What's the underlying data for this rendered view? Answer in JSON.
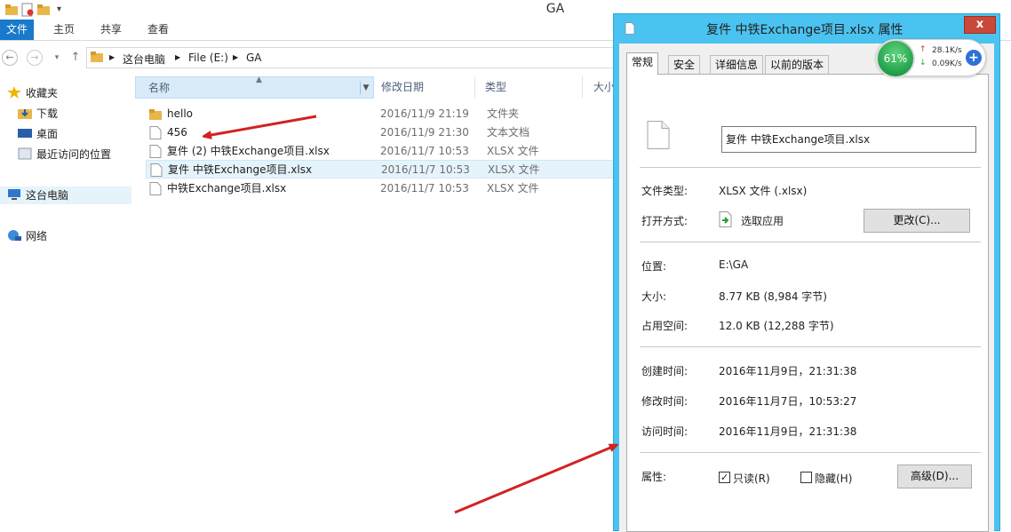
{
  "window": {
    "title": "GA"
  },
  "ribbon": {
    "tabs": [
      "文件",
      "主页",
      "共享",
      "查看"
    ]
  },
  "address": {
    "parts": [
      "这台电脑",
      "File (E:)",
      "GA"
    ]
  },
  "nav_pane": {
    "favorites": "收藏夹",
    "downloads": "下载",
    "desktop": "桌面",
    "recent": "最近访问的位置",
    "this_pc": "这台电脑",
    "network": "网络"
  },
  "columns": {
    "name": "名称",
    "modified": "修改日期",
    "type": "类型",
    "size": "大小"
  },
  "files": [
    {
      "name": "hello",
      "date": "2016/11/9 21:19",
      "type": "文件夹",
      "icon": "folder-icon"
    },
    {
      "name": "456",
      "date": "2016/11/9 21:30",
      "type": "文本文档",
      "icon": "text-file-icon"
    },
    {
      "name": "复件 (2) 中铁Exchange项目.xlsx",
      "date": "2016/11/7 10:53",
      "type": "XLSX 文件",
      "icon": "file-icon"
    },
    {
      "name": "复件 中铁Exchange项目.xlsx",
      "date": "2016/11/7 10:53",
      "type": "XLSX 文件",
      "icon": "file-icon"
    },
    {
      "name": "中铁Exchange项目.xlsx",
      "date": "2016/11/7 10:53",
      "type": "XLSX 文件",
      "icon": "file-icon"
    }
  ],
  "properties": {
    "title": "复件 中铁Exchange项目.xlsx 属性",
    "close": "x",
    "tabs": [
      "常规",
      "安全",
      "详细信息",
      "以前的版本"
    ],
    "filename": "复件 中铁Exchange项目.xlsx",
    "file_type_label": "文件类型:",
    "file_type_value": "XLSX 文件 (.xlsx)",
    "open_with_label": "打开方式:",
    "open_with_value": "选取应用",
    "change_button": "更改(C)...",
    "location_label": "位置:",
    "location_value": "E:\\GA",
    "size_label": "大小:",
    "size_value": "8.77 KB (8,984 字节)",
    "disk_size_label": "占用空间:",
    "disk_size_value": "12.0 KB (12,288 字节)",
    "created_label": "创建时间:",
    "created_value": "2016年11月9日，21:31:38",
    "modified_label": "修改时间:",
    "modified_value": "2016年11月7日，10:53:27",
    "accessed_label": "访问时间:",
    "accessed_value": "2016年11月9日，21:31:38",
    "attributes_label": "属性:",
    "readonly_label": "只读(R)",
    "readonly_checked": true,
    "hidden_label": "隐藏(H)",
    "hidden_checked": false,
    "advanced_button": "高级(D)..."
  },
  "net_widget": {
    "percent": "61%",
    "up": "28.1K/s",
    "down": "0.09K/s",
    "plus": "+"
  },
  "colors": {
    "accent": "#1979ca",
    "dialog_frame": "#4ac3f0",
    "arrow": "#d22222"
  }
}
